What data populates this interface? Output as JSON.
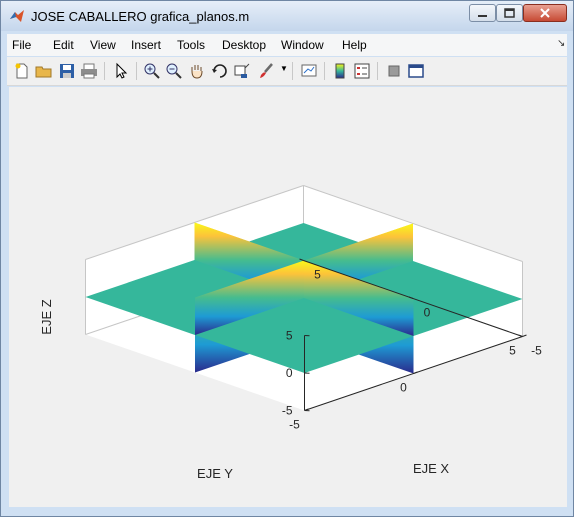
{
  "window": {
    "title": "JOSE CABALLERO grafica_planos.m"
  },
  "menu": {
    "items": [
      "File",
      "Edit",
      "View",
      "Insert",
      "Tools",
      "Desktop",
      "Window",
      "Help"
    ]
  },
  "toolbar": {
    "buttons": [
      "new-figure-icon",
      "open-file-icon",
      "save-icon",
      "print-icon",
      "select-arrow-icon",
      "zoom-in-icon",
      "zoom-out-icon",
      "pan-hand-icon",
      "rotate-3d-icon",
      "data-cursor-icon",
      "brush-icon",
      "link-plot-icon",
      "colorbar-icon",
      "legend-icon",
      "hide-plot-tools-icon",
      "show-plot-tools-icon"
    ]
  },
  "axes": {
    "z_label": "EJE Z",
    "y_label": "EJE Y",
    "x_label": "EJE X",
    "z_ticks": [
      "5",
      "0",
      "-5"
    ],
    "y_ticks": [
      "-5",
      "0",
      "5"
    ],
    "x_ticks": [
      "-5",
      "0",
      "5"
    ]
  },
  "colors": {
    "plane_z0": "#35b79b",
    "gradient_top": "#f9f71a",
    "gradient_mid": "#fcc33a",
    "gradient_low": "#45bc8f",
    "gradient_bottom": "#2a2a8c"
  },
  "chart_data": {
    "type": "surface-3d",
    "surfaces": [
      {
        "plane": "z = 0",
        "x_range": [
          -5,
          5
        ],
        "y_range": [
          -5,
          5
        ]
      },
      {
        "plane": "x = 0",
        "y_range": [
          -5,
          5
        ],
        "z_range": [
          -5,
          5
        ]
      },
      {
        "plane": "y = 0",
        "x_range": [
          -5,
          5
        ],
        "z_range": [
          -5,
          5
        ]
      }
    ],
    "xlabel": "EJE X",
    "ylabel": "EJE Y",
    "zlabel": "EJE Z",
    "xlim": [
      -5,
      5
    ],
    "ylim": [
      -5,
      5
    ],
    "zlim": [
      -5,
      5
    ],
    "grid": false,
    "colormap": "parula"
  }
}
